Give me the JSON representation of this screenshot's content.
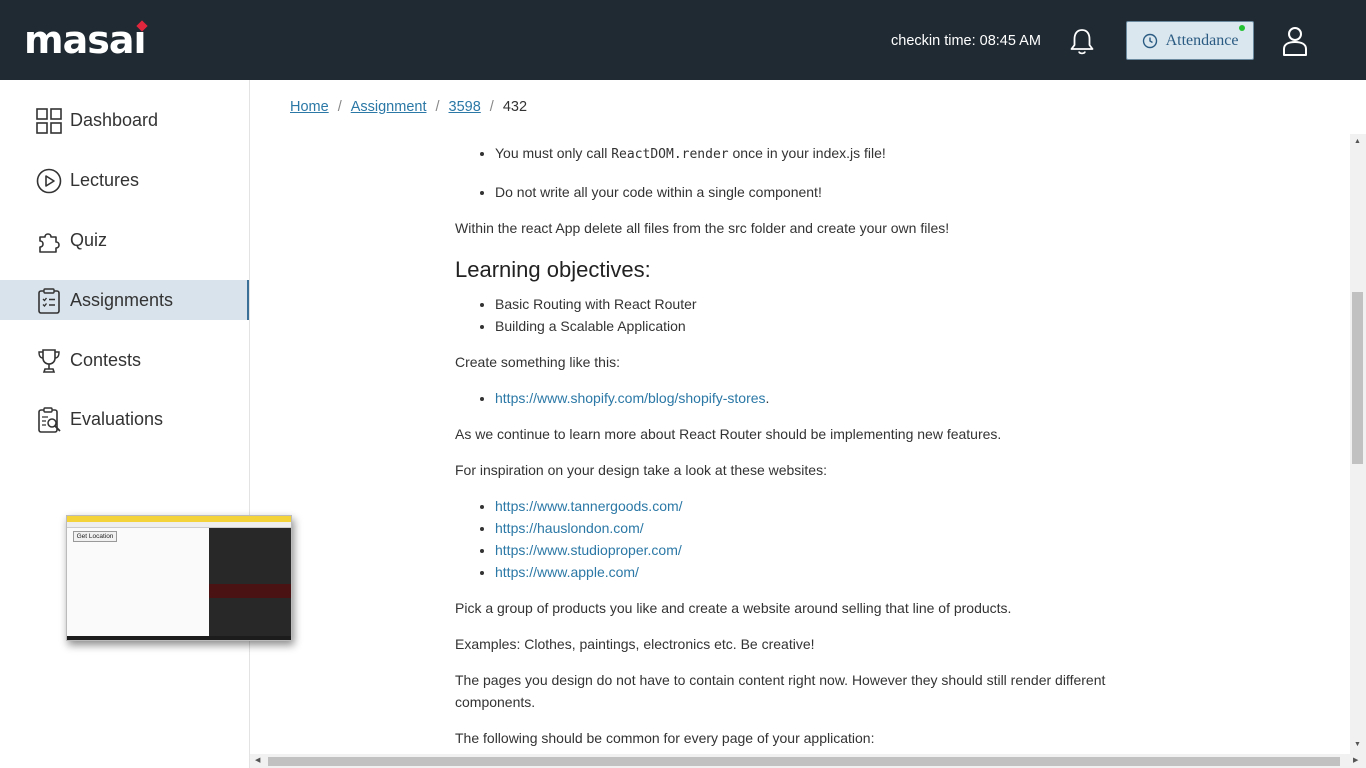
{
  "header": {
    "logo_text": "masai",
    "checkin_text": "checkin time: 08:45 AM",
    "attendance_label": "Attendance",
    "attendance_status_color": "#22c232",
    "icons": [
      "bell-icon",
      "clock-icon",
      "user-icon"
    ]
  },
  "sidebar": {
    "items": [
      {
        "label": "Dashboard",
        "icon": "grid-icon"
      },
      {
        "label": "Lectures",
        "icon": "play-circle-icon"
      },
      {
        "label": "Quiz",
        "icon": "puzzle-icon"
      },
      {
        "label": "Assignments",
        "icon": "clipboard-icon",
        "active": true
      },
      {
        "label": "Contests",
        "icon": "trophy-icon"
      },
      {
        "label": "Evaluations",
        "icon": "evaluation-icon"
      }
    ],
    "preview_button": "Get Location"
  },
  "breadcrumb": {
    "home": "Home",
    "assignment": "Assignment",
    "id": "3598",
    "current": "432"
  },
  "content": {
    "bullet_1_pre": "You must only call ",
    "bullet_1_code": "ReactDOM.render",
    "bullet_1_post": " once in your index.js file!",
    "bullet_2": "Do not write all your code within a single component!",
    "para_1": "Within the react App delete all files from the src folder and create your own files!",
    "heading": "Learning objectives:",
    "objectives": [
      "Basic Routing with React Router",
      "Building a Scalable Application"
    ],
    "para_2": "Create something like this:",
    "example_link": "https://www.shopify.com/blog/shopify-stores",
    "para_3": "As we continue to learn more about React Router should be implementing new features.",
    "para_4": "For inspiration on your design take a look at these websites:",
    "links": [
      "https://www.tannergoods.com/",
      "https://hauslondon.com/",
      "https://www.studioproper.com/",
      "https://www.apple.com/"
    ],
    "para_5": "Pick a group of products you like and create a website around selling that line of products.",
    "para_6": "Examples: Clothes, paintings, electronics etc. Be creative!",
    "para_7": "The pages you design do not have to contain content right now. However they should still render different components.",
    "para_8": "The following should be common for every page of your application:"
  }
}
